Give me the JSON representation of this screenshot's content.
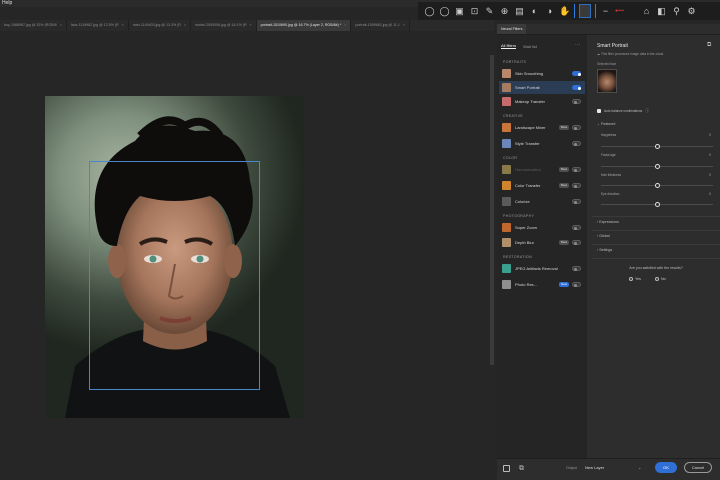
{
  "menu": {
    "help": "Help"
  },
  "toolbar": {
    "icons": [
      "ellipse-select-icon",
      "ellipse-icon",
      "image-icon",
      "crop-icon",
      "pen-icon",
      "zoom-icon",
      "layer-icon",
      "lasso-icon",
      "brush-icon",
      "hand-icon",
      "face-thumbnail",
      "minus-icon",
      "stamp-icon",
      "flip-icon",
      "heal-icon",
      "gear-icon"
    ]
  },
  "tabs": [
    {
      "label": "boy-1566967.jpg @ 33% (RGB/8",
      "active": false
    },
    {
      "label": "face-1119982.jpg @ 12.5% (R",
      "active": false
    },
    {
      "label": "man-1149403.jpg @ 13.3% (R",
      "active": false
    },
    {
      "label": "model-2549006.jpg @ 18.1% (R",
      "active": false
    },
    {
      "label": "portrait-1510690.jpg @ 16.7% (Layer 2, RGB/8#) *",
      "active": true
    },
    {
      "label": "portrait-1599662.jpg @ 11.1",
      "active": false
    }
  ],
  "panel": {
    "tab_label": "Neural Filters",
    "filter_tabs": [
      {
        "label": "All filters",
        "active": true
      },
      {
        "label": "Wait list",
        "active": false
      }
    ],
    "more": "···",
    "categories": {
      "portraits": "PORTRAITS",
      "creative": "CREATIVE",
      "color": "COLOR",
      "photography": "PHOTOGRAPHY",
      "restoration": "RESTORATION"
    },
    "filters": [
      {
        "label": "Skin Smoothing",
        "on": true,
        "selected": false,
        "badge": "",
        "disabled": false,
        "color": "#b9876c"
      },
      {
        "label": "Smart Portrait",
        "on": true,
        "selected": true,
        "badge": "",
        "disabled": false,
        "color": "#a77b60"
      },
      {
        "label": "Makeup Transfer",
        "on": false,
        "selected": false,
        "badge": "",
        "disabled": false,
        "color": "#c56b6b"
      },
      {
        "label": "Landscape Mixer",
        "on": false,
        "selected": false,
        "badge": "Beta",
        "disabled": false,
        "color": "#c8743a"
      },
      {
        "label": "Style Transfer",
        "on": false,
        "selected": false,
        "badge": "",
        "disabled": false,
        "color": "#6b86b8"
      },
      {
        "label": "Harmonization",
        "on": false,
        "selected": false,
        "badge": "Beta",
        "disabled": true,
        "color": "#8a7a4a"
      },
      {
        "label": "Color Transfer",
        "on": false,
        "selected": false,
        "badge": "Beta",
        "disabled": false,
        "color": "#d1852e"
      },
      {
        "label": "Colorize",
        "on": false,
        "selected": false,
        "badge": "",
        "disabled": false,
        "color": "#5a5a5a"
      },
      {
        "label": "Super Zoom",
        "on": false,
        "selected": false,
        "badge": "",
        "disabled": false,
        "color": "#c0672e"
      },
      {
        "label": "Depth Blur",
        "on": false,
        "selected": false,
        "badge": "Beta",
        "disabled": false,
        "color": "#b08f6a"
      },
      {
        "label": "JPEG Artifacts Removal",
        "on": false,
        "selected": false,
        "badge": "",
        "disabled": false,
        "color": "#3aa08f"
      },
      {
        "label": "Photo Res...",
        "on": false,
        "selected": false,
        "badge": "New",
        "disabled": false,
        "color": "#8f8f8f"
      }
    ]
  },
  "settings": {
    "title": "Smart Portrait",
    "note": "This filter processes image data in the cloud.",
    "selected_face_label": "Selected face",
    "auto_balance": "Auto balance combinations",
    "featured": "Featured",
    "sliders": [
      {
        "label": "Happiness",
        "value": "0",
        "level": 0.5
      },
      {
        "label": "Facial age",
        "value": "0",
        "level": 0.5
      },
      {
        "label": "Hair thickness",
        "value": "0",
        "level": 0.5
      },
      {
        "label": "Eye direction",
        "value": "0",
        "level": 0.5
      }
    ],
    "expressions": "Expressions",
    "global": "Global",
    "settings_label": "Settings",
    "question": "Are you satisfied with the results?",
    "yes": "Yes",
    "no": "No"
  },
  "bottom": {
    "output_label": "Output",
    "output_value": "New Layer",
    "ok": "OK",
    "cancel": "Cancel"
  }
}
